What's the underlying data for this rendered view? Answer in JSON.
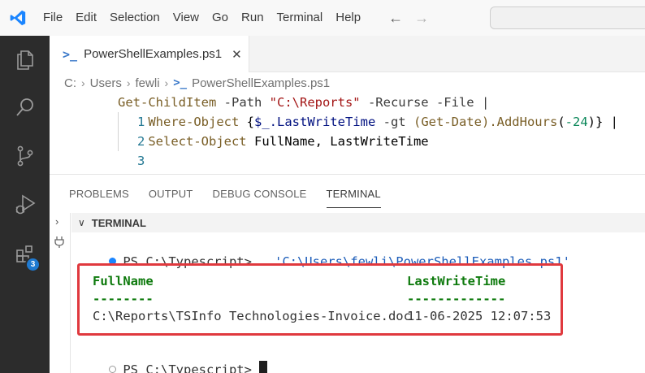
{
  "menu": [
    "File",
    "Edit",
    "Selection",
    "View",
    "Go",
    "Run",
    "Terminal",
    "Help"
  ],
  "tab": {
    "label": "PowerShellExamples.ps1",
    "close": "✕",
    "icon": "powershell-icon"
  },
  "breadcrumb": {
    "drive": "C:",
    "users": "Users",
    "user": "fewli",
    "file": "PowerShellExamples.ps1"
  },
  "editor": {
    "lines": [
      {
        "number": "1",
        "tokens": [
          {
            "t": "Get-ChildItem",
            "c": "cmd"
          },
          {
            "t": " -Path ",
            "c": "param"
          },
          {
            "t": "\"C:\\Reports\"",
            "c": "str"
          },
          {
            "t": " -Recurse -File |",
            "c": "param"
          }
        ]
      },
      {
        "number": "2",
        "tokens": [
          {
            "t": "    Where-Object ",
            "c": "cmd"
          },
          {
            "t": "{",
            "c": "plain"
          },
          {
            "t": "$_",
            "c": "var"
          },
          {
            "t": ".LastWriteTime",
            "c": "var"
          },
          {
            "t": " -gt ",
            "c": "param"
          },
          {
            "t": "(Get-Date)",
            "c": "cmd"
          },
          {
            "t": ".AddHours",
            "c": "cmd"
          },
          {
            "t": "(",
            "c": "plain"
          },
          {
            "t": "-24",
            "c": "num"
          },
          {
            "t": ")} |",
            "c": "plain"
          }
        ]
      },
      {
        "number": "3",
        "tokens": [
          {
            "t": "    Select-Object ",
            "c": "cmd"
          },
          {
            "t": "FullName, LastWriteTime",
            "c": "plain"
          }
        ]
      }
    ]
  },
  "panel": {
    "tabs": [
      "PROBLEMS",
      "OUTPUT",
      "DEBUG CONSOLE",
      "TERMINAL"
    ],
    "active_tab": "TERMINAL",
    "section_title": "TERMINAL"
  },
  "terminal": {
    "prompt1": "PS C:\\Typescript> ",
    "command_dot": ". ",
    "command_path": "'C:\\Users\\fewli\\PowerShellExamples.ps1'",
    "col1_header": "FullName",
    "col2_header": "LastWriteTime",
    "col1_rule": "--------",
    "col2_rule": "-------------",
    "row_fullname": "C:\\Reports\\TSInfo Technologies-Invoice.doc",
    "row_lastwrite": "11-06-2025 12:07:53",
    "prompt2": "PS C:\\Typescript> "
  },
  "extensions_badge": "3",
  "colors": {
    "accent": "#1a85ff",
    "highlight_box": "#e0393e",
    "header_green": "#0e7a0d"
  }
}
